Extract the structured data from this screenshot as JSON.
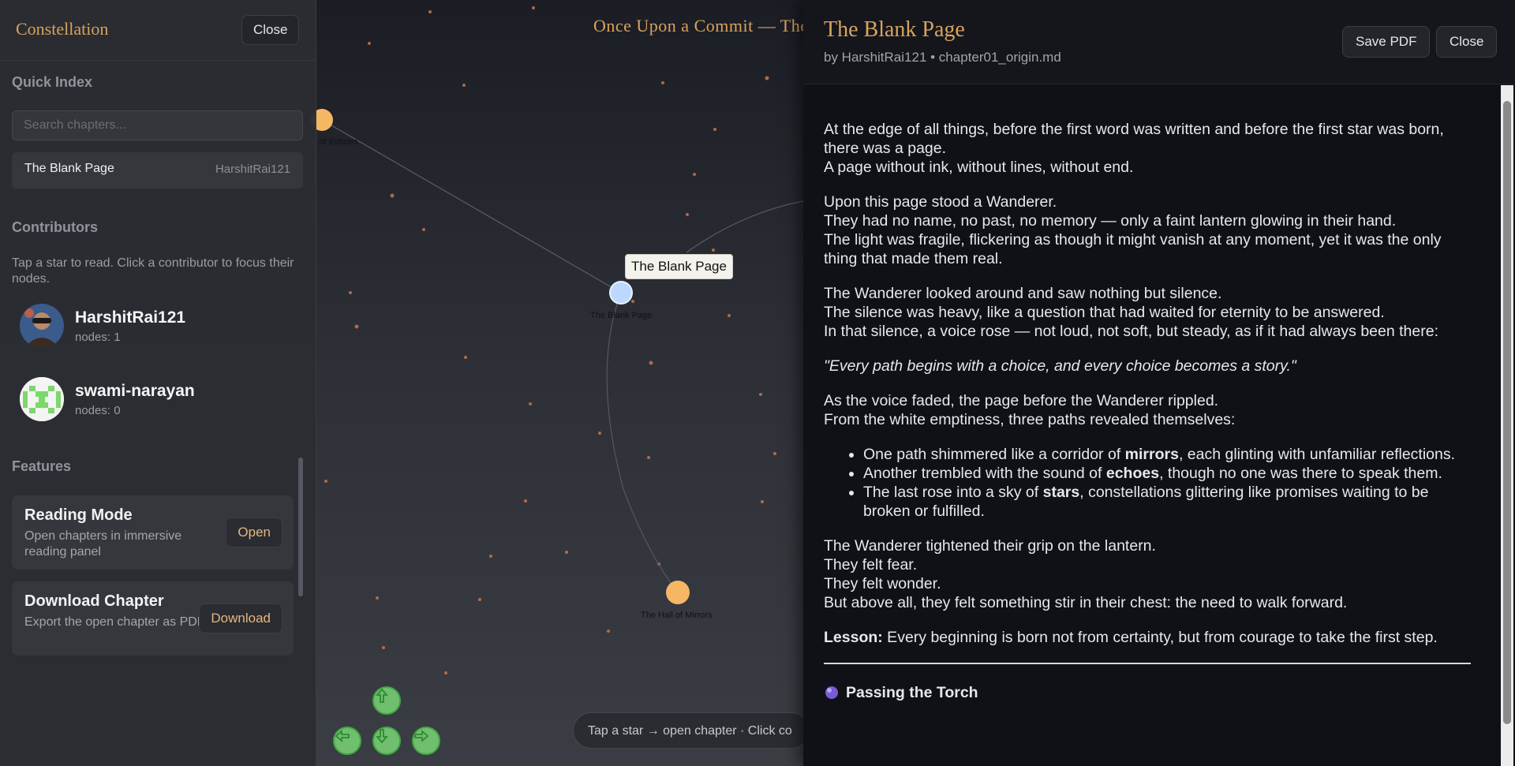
{
  "sky": {
    "title": "Once Upon a Commit — The",
    "nodes": [
      {
        "label": "y of Echoes"
      },
      {
        "label": "The Blank Page"
      },
      {
        "label": "The Hall of Mirrors"
      }
    ],
    "tooltip": "The Blank Page",
    "hint": "Tap a star → open chapter · Click co",
    "colors": {
      "node_active": "#bcd8ff",
      "node": "#f6b765",
      "accent": "#d9a25f"
    }
  },
  "sidebar": {
    "title": "Constellation",
    "close_label": "Close",
    "quick_index": {
      "title": "Quick Index",
      "search_placeholder": "Search chapters...",
      "chapters": [
        {
          "title": "The Blank Page",
          "author": "HarshitRai121"
        }
      ]
    },
    "contributors": {
      "title": "Contributors",
      "help": "Tap a star to read. Click a contributor to focus their nodes.",
      "items": [
        {
          "name": "HarshitRai121",
          "nodes": "nodes: 1",
          "avatar_icon": "photo-avatar-icon"
        },
        {
          "name": "swami-narayan",
          "nodes": "nodes: 0",
          "avatar_icon": "identicon-avatar-icon"
        }
      ]
    },
    "features": {
      "title": "Features",
      "items": [
        {
          "title": "Reading Mode",
          "desc": "Open chapters in immersive reading panel",
          "button": "Open"
        },
        {
          "title": "Download Chapter",
          "desc": "Export the open chapter as PDF",
          "button": "Download"
        }
      ]
    }
  },
  "reader": {
    "title": "The Blank Page",
    "meta": "by HarshitRai121 • chapter01_origin.md",
    "save_pdf_label": "Save PDF",
    "close_label": "Close",
    "p1": [
      "At the edge of all things, before the first word was written and before the first star was born, there was a page.",
      "A page without ink, without lines, without end."
    ],
    "p2": [
      "Upon this page stood a Wanderer.",
      "They had no name, no past, no memory — only a faint lantern glowing in their hand.",
      "The light was fragile, flickering as though it might vanish at any moment, yet it was the only thing that made them real."
    ],
    "p3": [
      "The Wanderer looked around and saw nothing but silence.",
      "The silence was heavy, like a question that had waited for eternity to be answered.",
      "In that silence, a voice rose — not loud, not soft, but steady, as if it had always been there:"
    ],
    "quote": "\"Every path begins with a choice, and every choice becomes a story.\"",
    "p4": [
      "As the voice faded, the page before the Wanderer rippled.",
      "From the white emptiness, three paths revealed themselves:"
    ],
    "list": [
      {
        "pre": "One path shimmered like a corridor of ",
        "bold": "mirrors",
        "post": ", each glinting with unfamiliar reflections."
      },
      {
        "pre": "Another trembled with the sound of ",
        "bold": "echoes",
        "post": ", though no one was there to speak them."
      },
      {
        "pre": "The last rose into a sky of ",
        "bold": "stars",
        "post": ", constellations glittering like promises waiting to be broken or fulfilled."
      }
    ],
    "p5": [
      "The Wanderer tightened their grip on the lantern.",
      "They felt fear.",
      "They felt wonder.",
      "But above all, they felt something stir in their chest: the need to walk forward."
    ],
    "lesson_label": "Lesson:",
    "lesson_text": " Every beginning is born not from certainty, but from courage to take the first step.",
    "next_heading": "Passing the Torch"
  }
}
